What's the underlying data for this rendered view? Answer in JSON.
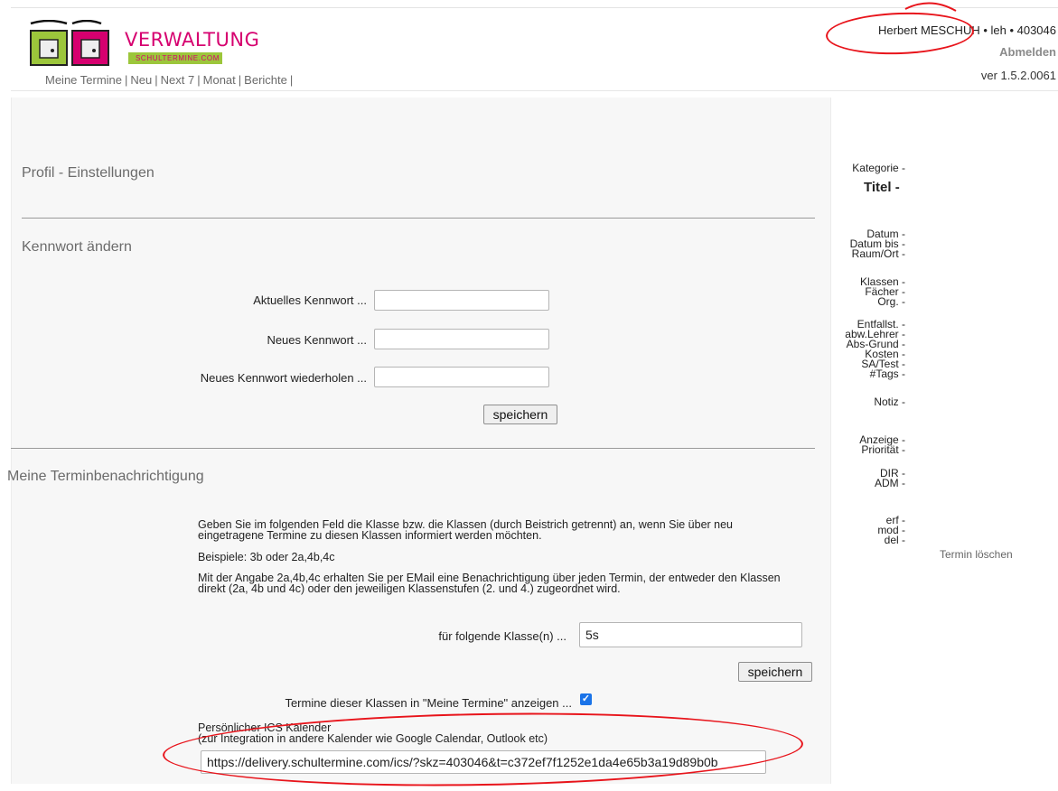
{
  "header": {
    "logo_main": "VERWALTUNG",
    "logo_sub": "SCHULTERMINE.COM",
    "user": "Herbert MESCHUH • leh • 403046",
    "logout": "Abmelden",
    "version": "ver 1.5.2.0061"
  },
  "nav": {
    "items": [
      "Meine Termine",
      "Neu",
      "Next 7",
      "Monat",
      "Berichte"
    ]
  },
  "profile": {
    "title": "Profil - Einstellungen"
  },
  "password": {
    "title": "Kennwort ändern",
    "current_label": "Aktuelles Kennwort ...",
    "new_label": "Neues Kennwort ...",
    "repeat_label": "Neues Kennwort wiederholen ...",
    "current_value": "",
    "new_value": "",
    "repeat_value": "",
    "save_label": "speichern"
  },
  "notification": {
    "title": "Meine Terminbenachrichtigung",
    "intro_line1": "Geben Sie im folgenden Feld die Klasse bzw. die Klassen (durch Beistrich getrennt) an, wenn Sie über neu",
    "intro_line2": "eingetragene Termine zu diesen Klassen informiert werden möchten.",
    "examples": "Beispiele: 3b oder 2a,4b,4c",
    "detail_line1": "Mit der Angabe 2a,4b,4c erhalten Sie per EMail eine Benachrichtigung über jeden Termin, der entweder den Klassen",
    "detail_line2": "direkt (2a, 4b und 4c) oder den jeweiligen Klassenstufen (2. und 4.) zugeordnet wird.",
    "class_label": "für folgende Klasse(n) ...",
    "class_value": "5s",
    "save_label": "speichern",
    "show_label": "Termine dieser Klassen in \"Meine Termine\" anzeigen ...",
    "show_checked": true,
    "ics_title": "Persönlicher ICS Kalender",
    "ics_sub": "(zur Integration in andere Kalender wie Google Calendar, Outlook etc)",
    "ics_url": "https://delivery.schultermine.com/ics/?skz=403046&t=c372ef7f1252e1da4e65b3a19d89b0b"
  },
  "info": {
    "kategorie": "Kategorie -",
    "titel": "Titel -",
    "datum": "Datum -",
    "datum_bis": "Datum bis -",
    "raum": "Raum/Ort -",
    "klassen": "Klassen -",
    "faecher": "Fächer -",
    "org": "Org. -",
    "entfallst": "Entfallst. -",
    "abw_lehrer": "abw.Lehrer -",
    "abs_grund": "Abs-Grund -",
    "kosten": "Kosten -",
    "sa_test": "SA/Test -",
    "tags": "#Tags -",
    "notiz": "Notiz -",
    "anzeige": "Anzeige -",
    "prioritaet": "Priorität -",
    "dir": "DIR -",
    "adm": "ADM -",
    "erf": "erf -",
    "mod": "mod -",
    "del": "del -",
    "delete_link": "Termin löschen"
  },
  "colors": {
    "logo_pink": "#d6006f",
    "logo_green": "#9cc63b",
    "checkbox": "#1a73e8",
    "annotation": "#e8141b"
  }
}
